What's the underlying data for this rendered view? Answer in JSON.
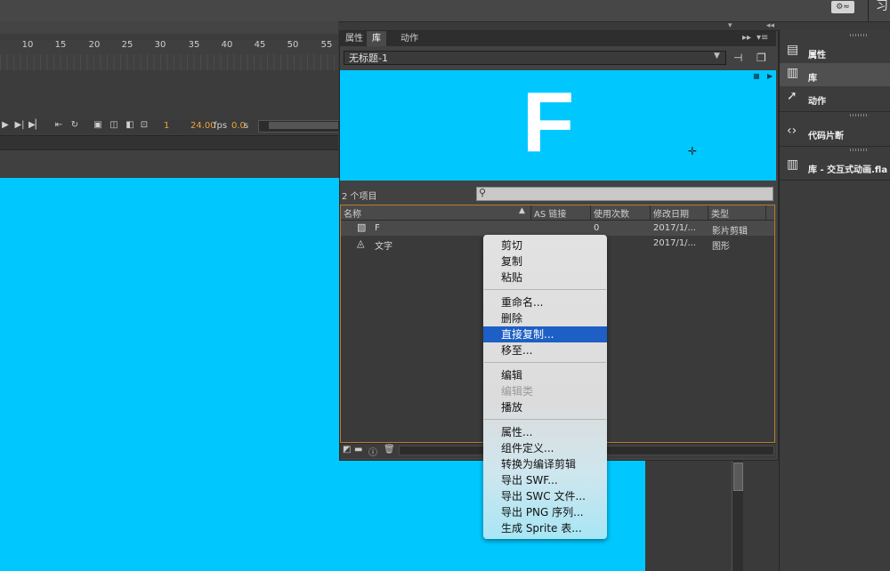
{
  "topbar": {
    "gear_label": "⚙≈",
    "partial_text": "习"
  },
  "timeline": {
    "ticks": [
      "10",
      "15",
      "20",
      "25",
      "30",
      "35",
      "40",
      "45",
      "50",
      "55"
    ],
    "frame": "1",
    "fps_value": "24.00",
    "fps_unit": "fps",
    "sec_value": "0.0",
    "sec_unit": "s"
  },
  "library": {
    "tabs": [
      "属性",
      "库",
      "动作"
    ],
    "document": "无标题-1",
    "preview_letter": "F",
    "item_count": "2 个项目",
    "search_placeholder": "",
    "columns": [
      "名称",
      "AS 链接",
      "使用次数",
      "修改日期",
      "类型"
    ],
    "rows": [
      {
        "name": "F",
        "as_link": "",
        "use_count": "0",
        "date": "2017/1/...",
        "type": "影片剪辑",
        "icon": "movieclip-icon"
      },
      {
        "name": "文字",
        "as_link": "",
        "use_count": "",
        "date": "2017/1/...",
        "type": "图形",
        "icon": "graphic-icon"
      }
    ]
  },
  "context_menu": {
    "items": [
      {
        "label": "剪切",
        "state": "normal"
      },
      {
        "label": "复制",
        "state": "normal"
      },
      {
        "label": "粘贴",
        "state": "normal"
      },
      {
        "label": "重命名...",
        "state": "normal"
      },
      {
        "label": "删除",
        "state": "normal"
      },
      {
        "label": "直接复制...",
        "state": "highlighted"
      },
      {
        "label": "移至...",
        "state": "normal"
      },
      {
        "label": "编辑",
        "state": "normal"
      },
      {
        "label": "编辑类",
        "state": "disabled"
      },
      {
        "label": "播放",
        "state": "normal"
      },
      {
        "label": "属性...",
        "state": "normal"
      },
      {
        "label": "组件定义...",
        "state": "normal"
      },
      {
        "label": "转换为编译剪辑",
        "state": "normal"
      },
      {
        "label": "导出 SWF...",
        "state": "normal"
      },
      {
        "label": "导出 SWC 文件...",
        "state": "normal"
      },
      {
        "label": "导出 PNG 序列...",
        "state": "normal"
      },
      {
        "label": "生成 Sprite 表...",
        "state": "normal"
      }
    ]
  },
  "dock": {
    "items": [
      {
        "label": "属性",
        "icon": "properties-icon"
      },
      {
        "label": "库",
        "icon": "library-icon"
      },
      {
        "label": "动作",
        "icon": "actions-icon"
      },
      {
        "label": "代码片断",
        "icon": "code-snippets-icon"
      },
      {
        "label": "库 - 交互式动画.fla",
        "icon": "library-file-icon"
      }
    ]
  },
  "colors": {
    "stage": "#00c8ff",
    "highlight": "#1d5fc4",
    "accent": "#e8a33d"
  }
}
